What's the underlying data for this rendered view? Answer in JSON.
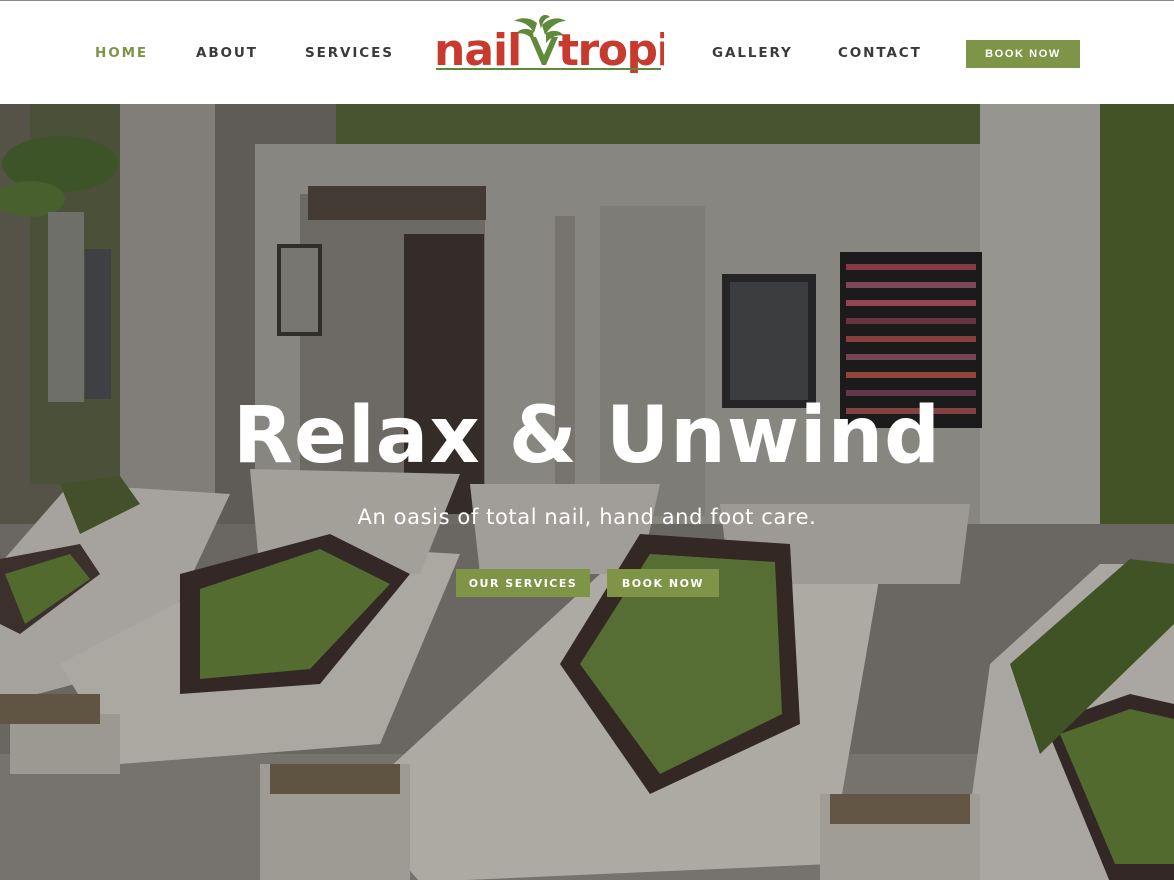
{
  "brand": {
    "name_part1": "nail",
    "name_part2": "tropics",
    "primary_color": "#7e9548",
    "logo_red": "#c8392e",
    "logo_green": "#5e8a3a"
  },
  "nav": {
    "left": [
      {
        "label": "HOME",
        "active": true
      },
      {
        "label": "ABOUT",
        "active": false
      },
      {
        "label": "SERVICES",
        "active": false
      }
    ],
    "right": [
      {
        "label": "GALLERY",
        "active": false
      },
      {
        "label": "CONTACT",
        "active": false
      }
    ],
    "book_label": "BOOK NOW"
  },
  "hero": {
    "title": "Relax & Unwind",
    "subtitle": "An oasis of total nail, hand and foot care.",
    "buttons": {
      "services_label": "OUR SERVICES",
      "book_label": "BOOK NOW"
    }
  },
  "icons": {
    "logo_mark": "palm-leaf-icon"
  }
}
